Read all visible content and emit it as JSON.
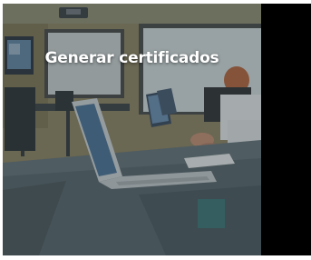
{
  "tile": {
    "caption": "Generar certificados",
    "image_subject": "computer-lab-photo",
    "overlay_color": "#3d4a4e",
    "caption_color": "#ffffff"
  },
  "side_band": {
    "color": "#000000"
  }
}
